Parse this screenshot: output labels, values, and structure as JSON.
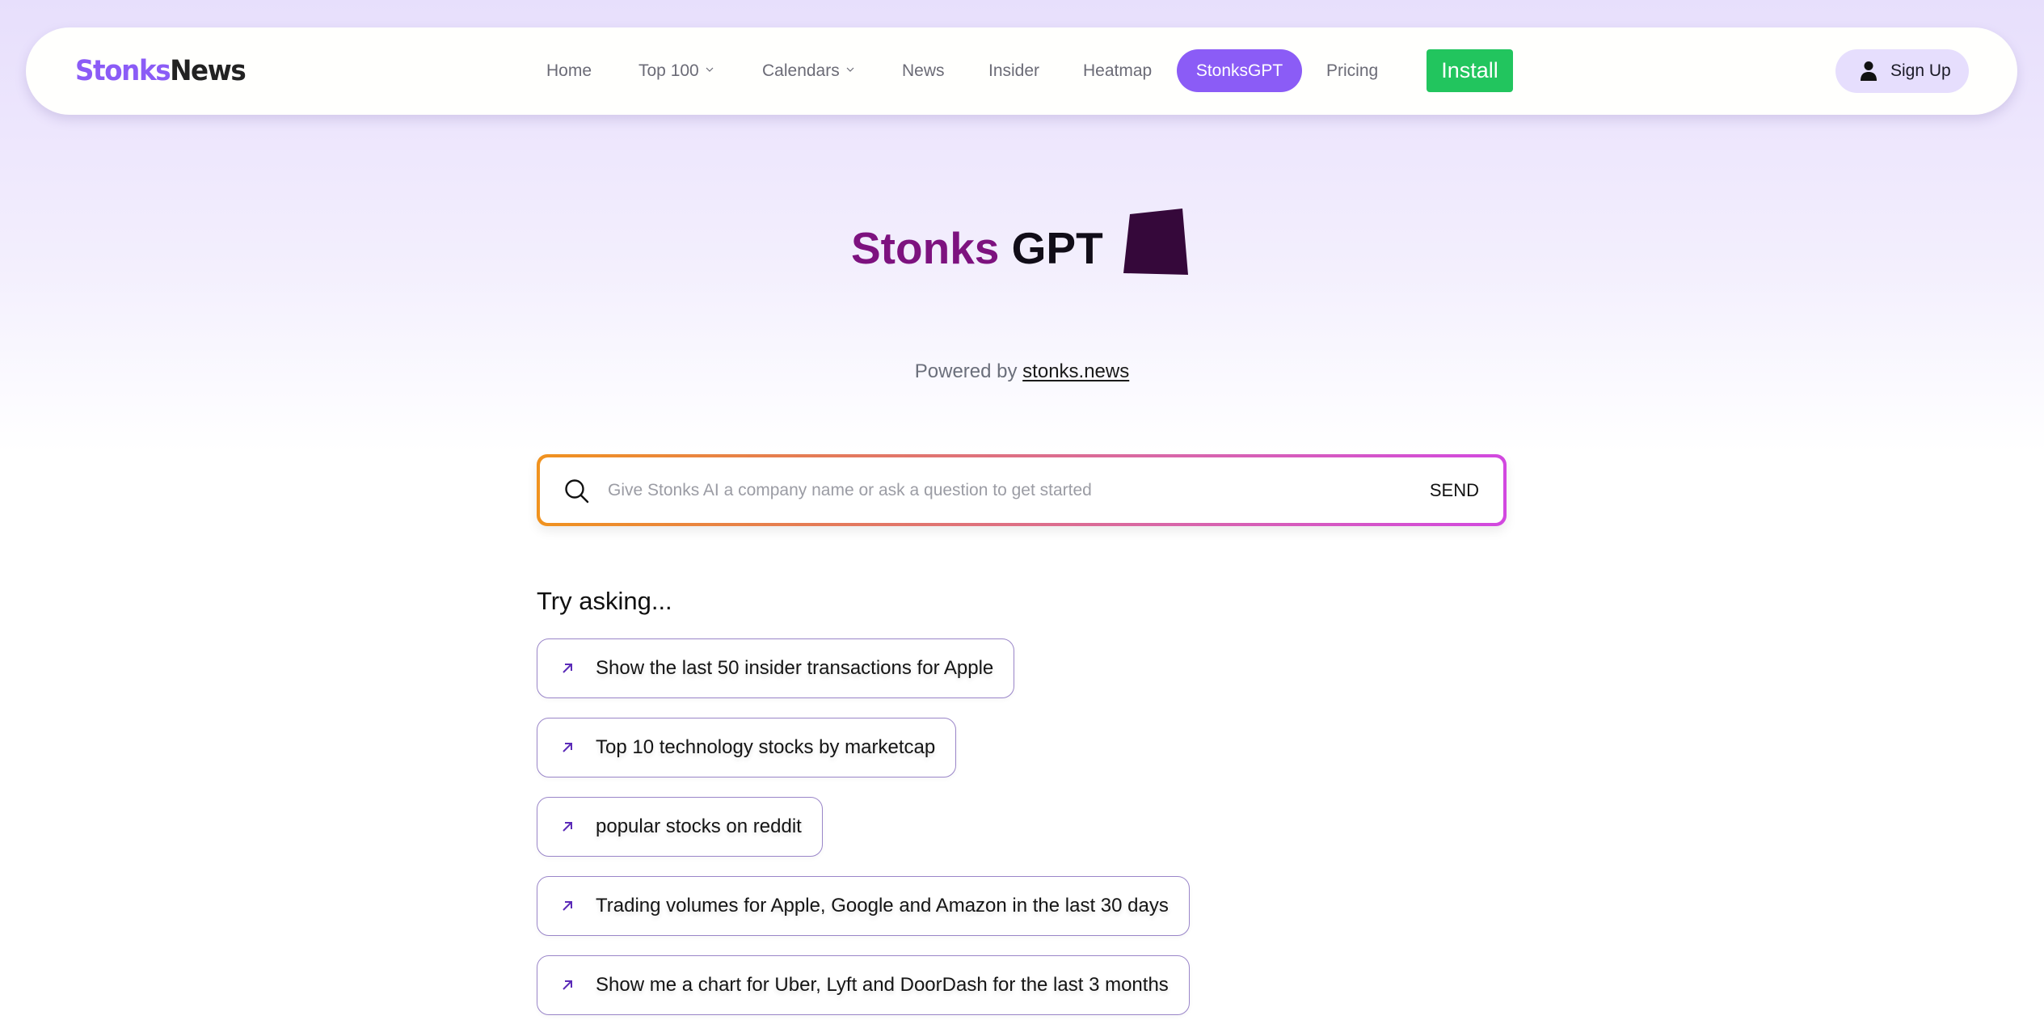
{
  "navbar": {
    "logo": {
      "part1": "Stonks",
      "part2": "News"
    },
    "items": [
      {
        "label": "Home",
        "has_dropdown": false
      },
      {
        "label": "Top 100",
        "has_dropdown": true
      },
      {
        "label": "Calendars",
        "has_dropdown": true
      },
      {
        "label": "News",
        "has_dropdown": false
      },
      {
        "label": "Insider",
        "has_dropdown": false
      },
      {
        "label": "Heatmap",
        "has_dropdown": false
      }
    ],
    "active_item": {
      "label": "StonksGPT"
    },
    "pricing": {
      "label": "Pricing"
    },
    "install_button": {
      "label": "Install"
    },
    "signup_button": {
      "label": "Sign Up",
      "icon": "user-icon"
    }
  },
  "hero": {
    "title_part1": "Stonks",
    "title_part2": "GPT",
    "title_icon": "cube-logo-icon",
    "powered_by_prefix": "Powered by",
    "powered_by_link": "stonks.news"
  },
  "search": {
    "icon": "search-icon",
    "value": "",
    "placeholder": "Give Stonks AI a company name or ask a question to get started",
    "send_label": "SEND"
  },
  "suggestions": {
    "title": "Try asking...",
    "icon": "arrow-up-right-icon",
    "items": [
      "Show the last 50 insider transactions for Apple",
      "Top 10 technology stocks by marketcap",
      "popular stocks on reddit",
      "Trading volumes for Apple, Google and Amazon in the last 30 days",
      "Show me a chart for Uber, Lyft and DoorDash for the last 3 months"
    ]
  },
  "colors": {
    "brand_purple": "#8b5cf6",
    "install_green": "#22c55e",
    "title_purple": "#7d127f",
    "signup_bg": "#e6defd",
    "search_border_start": "#f0921e",
    "search_border_end": "#d248e0"
  }
}
